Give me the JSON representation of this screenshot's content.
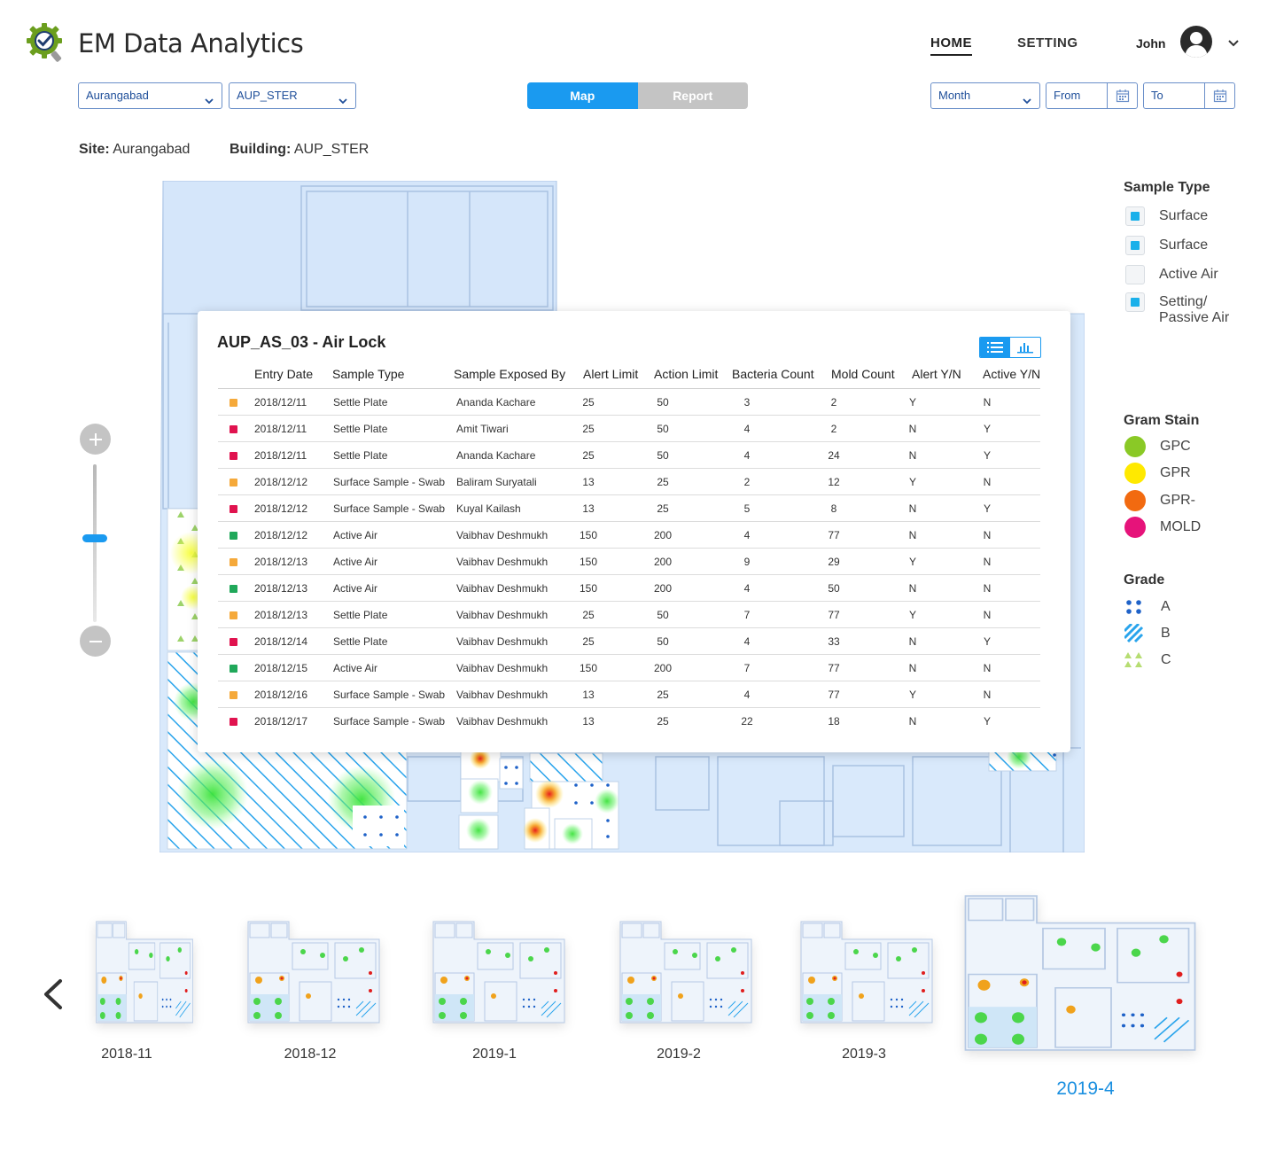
{
  "header": {
    "app_title": "EM Data Analytics",
    "nav": {
      "home": "HOME",
      "setting": "SETTING"
    },
    "user": "John"
  },
  "filters": {
    "site": "Aurangabad",
    "building": "AUP_STER",
    "view_tabs": [
      "Map",
      "Report"
    ],
    "active_view": "Map",
    "period": "Month",
    "from_placeholder": "From",
    "to_placeholder": "To"
  },
  "location": {
    "site_label": "Site:",
    "site_value": "Aurangabad",
    "building_label": "Building:",
    "building_value": "AUP_STER"
  },
  "popup": {
    "title": "AUP_AS_03 - Air Lock",
    "columns": [
      "Entry Date",
      "Sample Type",
      "Sample Exposed By",
      "Alert Limit",
      "Action Limit",
      "Bacteria Count",
      "Mold Count",
      "Alert Y/N",
      "Active Y/N"
    ],
    "rows": [
      {
        "status": "orange",
        "date": "2018/12/11",
        "type": "Settle Plate",
        "by": "Ananda Kachare",
        "alert": "25",
        "action": "50",
        "bacteria": "3",
        "mold": "2",
        "alert_yn": "Y",
        "active_yn": "N"
      },
      {
        "status": "red",
        "date": "2018/12/11",
        "type": "Settle Plate",
        "by": "Amit Tiwari",
        "alert": "25",
        "action": "50",
        "bacteria": "4",
        "mold": "2",
        "alert_yn": "N",
        "active_yn": "Y"
      },
      {
        "status": "red",
        "date": "2018/12/11",
        "type": "Settle Plate",
        "by": "Ananda Kachare",
        "alert": "25",
        "action": "50",
        "bacteria": "4",
        "mold": "24",
        "alert_yn": "N",
        "active_yn": "Y"
      },
      {
        "status": "orange",
        "date": "2018/12/12",
        "type": "Surface Sample - Swab",
        "by": "Baliram Suryatali",
        "alert": "13",
        "action": "25",
        "bacteria": "2",
        "mold": "12",
        "alert_yn": "Y",
        "active_yn": "N"
      },
      {
        "status": "red",
        "date": "2018/12/12",
        "type": "Surface Sample - Swab",
        "by": "Kuyal Kailash",
        "alert": "13",
        "action": "25",
        "bacteria": "5",
        "mold": "8",
        "alert_yn": "N",
        "active_yn": "Y"
      },
      {
        "status": "green",
        "date": "2018/12/12",
        "type": "Active Air",
        "by": "Vaibhav Deshmukh",
        "alert": "150",
        "action": "200",
        "bacteria": "4",
        "mold": "77",
        "alert_yn": "N",
        "active_yn": "N"
      },
      {
        "status": "orange",
        "date": "2018/12/13",
        "type": "Active Air",
        "by": "Vaibhav Deshmukh",
        "alert": "150",
        "action": "200",
        "bacteria": "9",
        "mold": "29",
        "alert_yn": "Y",
        "active_yn": "N"
      },
      {
        "status": "green",
        "date": "2018/12/13",
        "type": "Active Air",
        "by": "Vaibhav Deshmukh",
        "alert": "150",
        "action": "200",
        "bacteria": "4",
        "mold": "50",
        "alert_yn": "N",
        "active_yn": "N"
      },
      {
        "status": "orange",
        "date": "2018/12/13",
        "type": "Settle Plate",
        "by": "Vaibhav Deshmukh",
        "alert": "25",
        "action": "50",
        "bacteria": "7",
        "mold": "77",
        "alert_yn": "Y",
        "active_yn": "N"
      },
      {
        "status": "red",
        "date": "2018/12/14",
        "type": "Settle Plate",
        "by": "Vaibhav Deshmukh",
        "alert": "25",
        "action": "50",
        "bacteria": "4",
        "mold": "33",
        "alert_yn": "N",
        "active_yn": "Y"
      },
      {
        "status": "green",
        "date": "2018/12/15",
        "type": "Active Air",
        "by": "Vaibhav Deshmukh",
        "alert": "150",
        "action": "200",
        "bacteria": "7",
        "mold": "77",
        "alert_yn": "N",
        "active_yn": "N"
      },
      {
        "status": "orange",
        "date": "2018/12/16",
        "type": "Surface Sample - Swab",
        "by": "Vaibhav Deshmukh",
        "alert": "13",
        "action": "25",
        "bacteria": "4",
        "mold": "77",
        "alert_yn": "Y",
        "active_yn": "N"
      },
      {
        "status": "red",
        "date": "2018/12/17",
        "type": "Surface Sample - Swab",
        "by": "Vaibhav Deshmukh",
        "alert": "13",
        "action": "25",
        "bacteria": "22",
        "mold": "18",
        "alert_yn": "N",
        "active_yn": "Y"
      }
    ]
  },
  "status_colors": {
    "orange": "#f5a93a",
    "red": "#e0134f",
    "green": "#20a85a"
  },
  "legend": {
    "sample_type_title": "Sample Type",
    "sample_types": [
      {
        "label": "Surface",
        "checked": true
      },
      {
        "label": "Surface",
        "checked": true
      },
      {
        "label": "Active Air",
        "checked": false
      },
      {
        "label": "Setting/ Passive Air",
        "checked": true
      }
    ],
    "gram_stain_title": "Gram Stain",
    "gram_stains": [
      {
        "label": "GPC",
        "color": "#8ac926"
      },
      {
        "label": "GPR",
        "color": "#ffe900"
      },
      {
        "label": "GPR-",
        "color": "#f26a10"
      },
      {
        "label": "MOLD",
        "color": "#e6137a"
      }
    ],
    "grade_title": "Grade",
    "grades": [
      {
        "label": "A",
        "icon": "dots-icon"
      },
      {
        "label": "B",
        "icon": "hatch-icon"
      },
      {
        "label": "C",
        "icon": "triangles-icon"
      }
    ]
  },
  "timeline": {
    "months": [
      "2018-11",
      "2018-12",
      "2019-1",
      "2019-2",
      "2019-3",
      "2019-4"
    ],
    "active": "2019-4"
  }
}
